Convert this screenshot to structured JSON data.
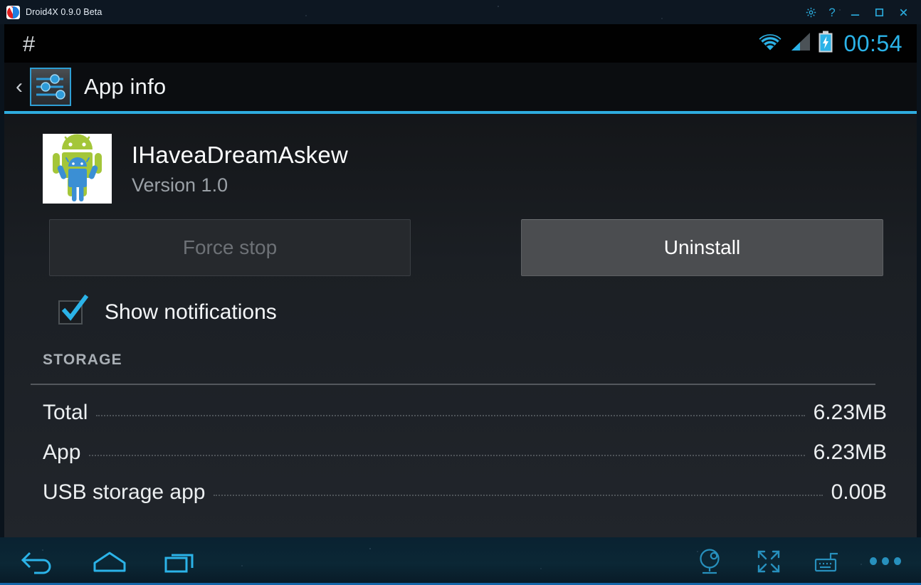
{
  "window": {
    "title": "Droid4X 0.9.0 Beta",
    "logo_icon": "droid4x-logo",
    "controls": [
      {
        "name": "settings-gear",
        "icon": "gear-icon"
      },
      {
        "name": "help",
        "icon": "question-mark-icon"
      },
      {
        "name": "minimize",
        "icon": "minimize-icon"
      },
      {
        "name": "maximize",
        "icon": "maximize-icon"
      },
      {
        "name": "close",
        "icon": "close-icon"
      }
    ]
  },
  "status_bar": {
    "left_glyph": "#",
    "clock": "00:54",
    "icons": [
      "wifi-icon",
      "signal-icon",
      "battery-charging-icon"
    ]
  },
  "action_bar": {
    "back_icon": "back-chevron-icon",
    "app_icon": "settings-sliders-icon",
    "title": "App info"
  },
  "app": {
    "icon": "android-robot-icon",
    "name": "IHaveaDreamAskew",
    "version": "Version 1.0"
  },
  "buttons": {
    "force_stop": "Force stop",
    "force_stop_enabled": false,
    "uninstall": "Uninstall",
    "uninstall_enabled": true
  },
  "notifications": {
    "label": "Show notifications",
    "checked": true
  },
  "storage": {
    "heading": "STORAGE",
    "rows": [
      {
        "label": "Total",
        "value": "6.23MB"
      },
      {
        "label": "App",
        "value": "6.23MB"
      },
      {
        "label": "USB storage app",
        "value": "0.00B"
      }
    ]
  },
  "nav_bar": {
    "items": [
      {
        "name": "back",
        "icon": "back-arrow-icon"
      },
      {
        "name": "home",
        "icon": "home-icon"
      },
      {
        "name": "recents",
        "icon": "recents-icon"
      }
    ]
  },
  "toolbar": {
    "items": [
      {
        "name": "camera",
        "icon": "webcam-icon"
      },
      {
        "name": "fullscreen",
        "icon": "fullscreen-icon"
      },
      {
        "name": "keyboard",
        "icon": "keyboard-icon"
      },
      {
        "name": "more",
        "icon": "more-dots-icon"
      }
    ]
  },
  "colors": {
    "accent_cyan": "#2bb3e8",
    "nav_bg": "#0b2a3a",
    "content_bg": "#1b1f24",
    "android_green": "#a4c639",
    "android_blue": "#3b8fd4"
  }
}
